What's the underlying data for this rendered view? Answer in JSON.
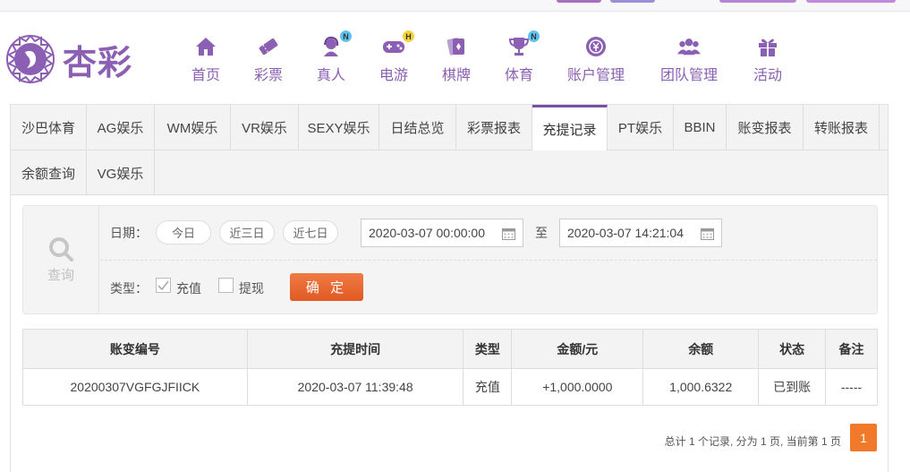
{
  "brand": {
    "name": "杏彩"
  },
  "nav": [
    {
      "label": "首页",
      "icon": "home-icon",
      "badge": ""
    },
    {
      "label": "彩票",
      "icon": "lottery-ticket-icon",
      "badge": ""
    },
    {
      "label": "真人",
      "icon": "live-dealer-icon",
      "badge": "N"
    },
    {
      "label": "电游",
      "icon": "gamepad-icon",
      "badge": "H"
    },
    {
      "label": "棋牌",
      "icon": "cards-icon",
      "badge": ""
    },
    {
      "label": "体育",
      "icon": "trophy-icon",
      "badge": "N"
    },
    {
      "label": "账户管理",
      "icon": "account-icon",
      "badge": ""
    },
    {
      "label": "团队管理",
      "icon": "team-icon",
      "badge": ""
    },
    {
      "label": "活动",
      "icon": "gift-icon",
      "badge": ""
    }
  ],
  "tabs": [
    {
      "label": "沙巴体育"
    },
    {
      "label": "AG娱乐"
    },
    {
      "label": "WM娱乐"
    },
    {
      "label": "VR娱乐"
    },
    {
      "label": "SEXY娱乐"
    },
    {
      "label": "日结总览"
    },
    {
      "label": "彩票报表"
    },
    {
      "label": "充提记录",
      "active": true
    },
    {
      "label": "PT娱乐"
    },
    {
      "label": "BBIN"
    },
    {
      "label": "账变报表"
    },
    {
      "label": "转账报表"
    },
    {
      "label": "余额查询"
    },
    {
      "label": "VG娱乐"
    }
  ],
  "search": {
    "side_label": "查询",
    "date_label": "日期：",
    "quick_ranges": [
      "今日",
      "近三日",
      "近七日"
    ],
    "start_date": "2020-03-07 00:00:00",
    "to_label": "至",
    "end_date": "2020-03-07 14:21:04",
    "type_label": "类型：",
    "type_options": [
      {
        "label": "充值",
        "checked": true
      },
      {
        "label": "提现",
        "checked": false
      }
    ],
    "confirm_label": "确 定"
  },
  "table": {
    "headers": [
      "账变编号",
      "充提时间",
      "类型",
      "金额/元",
      "余额",
      "状态",
      "备注"
    ],
    "rows": [
      [
        "20200307VGFGJFIICK",
        "2020-03-07 11:39:48",
        "充值",
        "+1,000.0000",
        "1,000.6322",
        "已到账",
        "-----"
      ]
    ]
  },
  "pager": {
    "info": "总计 1 个记录, 分为 1 页, 当前第 1 页",
    "current": "1"
  },
  "colors": {
    "brand": "#8b5fb3",
    "accent": "#f07a2a",
    "amount": "#e02020",
    "status_ok": "#2a9a2a"
  }
}
